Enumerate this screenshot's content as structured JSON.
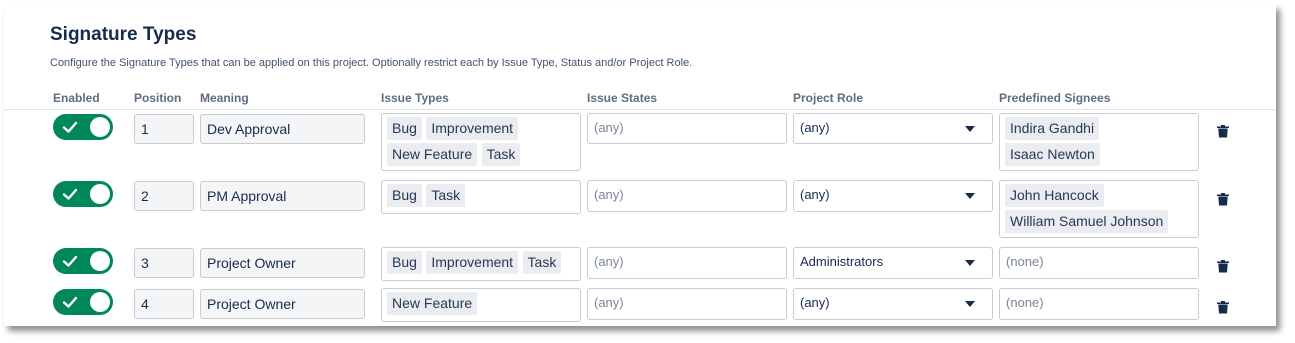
{
  "title": "Signature Types",
  "description": "Configure the Signature Types that can be applied on this project. Optionally restrict each by Issue Type, Status and/or Project Role.",
  "headers": {
    "enabled": "Enabled",
    "position": "Position",
    "meaning": "Meaning",
    "issue_types": "Issue Types",
    "issue_states": "Issue States",
    "project_role": "Project Role",
    "predefined_signees": "Predefined Signees"
  },
  "colors": {
    "toggle_on": "#00875a",
    "text": "#172b4d"
  },
  "rows": [
    {
      "enabled": true,
      "position": "1",
      "meaning": "Dev Approval",
      "issue_types": [
        "Bug",
        "Improvement",
        "New Feature",
        "Task"
      ],
      "issue_states": "(any)",
      "project_role": "(any)",
      "signees": [
        "Indira Gandhi",
        "Isaac Newton"
      ]
    },
    {
      "enabled": true,
      "position": "2",
      "meaning": "PM Approval",
      "issue_types": [
        "Bug",
        "Task"
      ],
      "issue_states": "(any)",
      "project_role": "(any)",
      "signees": [
        "John Hancock",
        "William Samuel Johnson"
      ]
    },
    {
      "enabled": true,
      "position": "3",
      "meaning": "Project Owner",
      "issue_types": [
        "Bug",
        "Improvement",
        "Task"
      ],
      "issue_states": "(any)",
      "project_role": "Administrators",
      "signees_empty": "(none)"
    },
    {
      "enabled": true,
      "position": "4",
      "meaning": "Project Owner",
      "issue_types": [
        "New Feature"
      ],
      "issue_states": "(any)",
      "project_role": "(any)",
      "signees_empty": "(none)"
    }
  ]
}
